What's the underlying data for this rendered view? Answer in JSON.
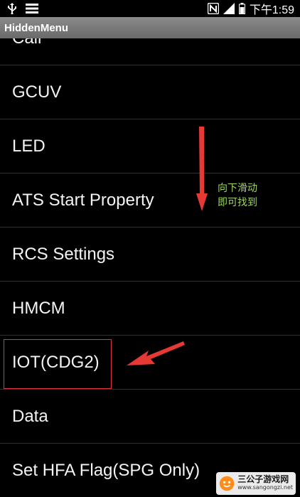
{
  "status_bar": {
    "time": "下午1:59",
    "icons": [
      "usb-icon",
      "menu-icon",
      "nfc-icon",
      "signal-icon",
      "battery-icon"
    ]
  },
  "app": {
    "title": "HiddenMenu"
  },
  "menu": {
    "items": [
      {
        "label": "Call"
      },
      {
        "label": "GCUV"
      },
      {
        "label": "LED"
      },
      {
        "label": "ATS Start Property"
      },
      {
        "label": "RCS Settings"
      },
      {
        "label": "HMCM"
      },
      {
        "label": "IOT(CDG2)"
      },
      {
        "label": "Data"
      },
      {
        "label": "Set HFA Flag(SPG Only)"
      }
    ]
  },
  "annotation": {
    "hint_line1": "向下滑动",
    "hint_line2": "即可找到",
    "arrow_color": "#e53935",
    "hint_color": "#9cd65c"
  },
  "watermark": {
    "name": "三公子游戏网",
    "url": "www.sangongzi.net"
  }
}
